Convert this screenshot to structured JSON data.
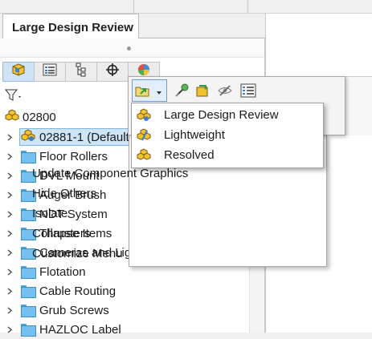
{
  "tab": {
    "title": "Large Design Review"
  },
  "tree": {
    "root": "02800",
    "selected": "02881-1 (Default<",
    "folders": [
      "Floor Rollers",
      "DVL Mount",
      "Auger Brush",
      "NDT System",
      "Thrusters",
      "Cameras and Lig",
      "Flotation",
      "Cable Routing",
      "Grub Screws",
      "HAZLOC Label"
    ]
  },
  "submenu": {
    "items": [
      {
        "label": "Large Design Review",
        "icon": "large-design-review-icon"
      },
      {
        "label": "Lightweight",
        "icon": "lightweight-icon"
      },
      {
        "label": "Resolved",
        "icon": "resolved-icon"
      }
    ]
  },
  "context_menu": {
    "items": [
      "Update Component Graphics",
      "Hide Others",
      "Isolate",
      "Collapse Items",
      "Customize Menu"
    ]
  },
  "colors": {
    "selection": "#cde5f7",
    "folder": "#74c0ef",
    "menu_hover_border": "#6c9bd0"
  }
}
